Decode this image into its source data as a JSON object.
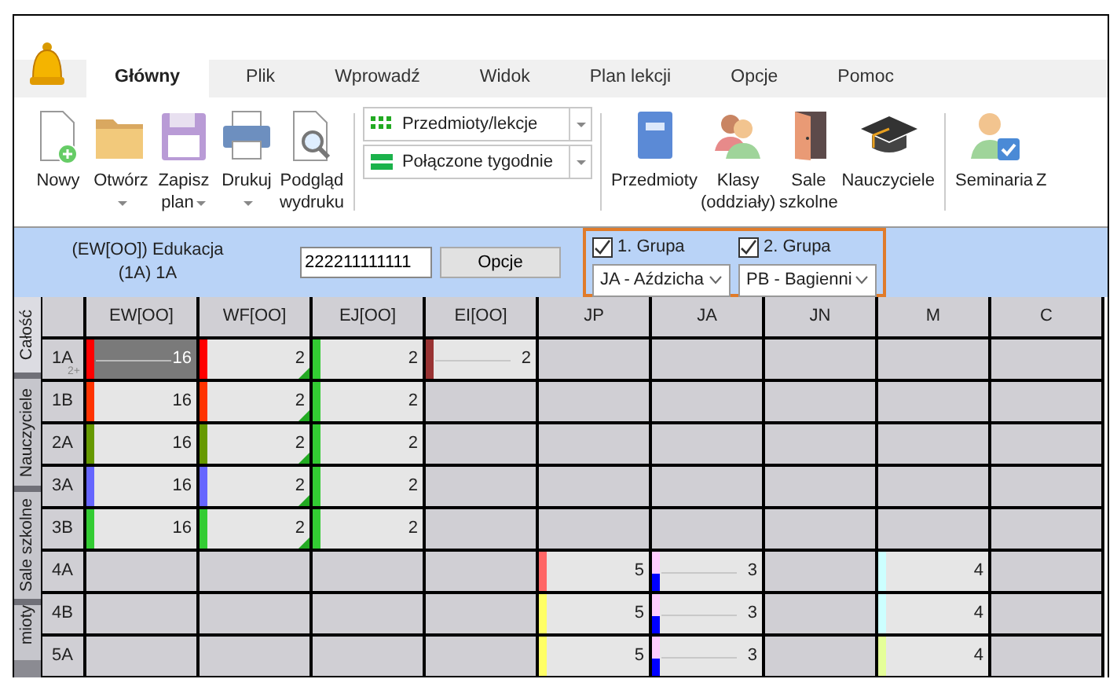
{
  "tabs": [
    {
      "label": "Główny",
      "selected": true
    },
    {
      "label": "Plik",
      "selected": false
    },
    {
      "label": "Wprowadź",
      "selected": false
    },
    {
      "label": "Widok",
      "selected": false
    },
    {
      "label": "Plan lekcji",
      "selected": false
    },
    {
      "label": "Opcje",
      "selected": false
    },
    {
      "label": "Pomoc",
      "selected": false
    }
  ],
  "ribbon": {
    "file_buttons": [
      {
        "label": "Nowy",
        "dropdown": false
      },
      {
        "label": "Otwórz",
        "dropdown": true
      },
      {
        "label": "Zapisz plan",
        "dropdown": true
      },
      {
        "label": "Drukuj",
        "dropdown": true
      },
      {
        "label": "Podgląd wydruku",
        "dropdown": false
      }
    ],
    "combos": [
      {
        "value": "Przedmioty/lekcje"
      },
      {
        "value": "Połączone tygodnie"
      }
    ],
    "data_buttons": [
      {
        "label": "Przedmioty"
      },
      {
        "label": "Klasy (oddziały)"
      },
      {
        "label": "Sale szkolne"
      },
      {
        "label": "Nauczyciele"
      }
    ],
    "extra_buttons": [
      {
        "label": "Seminaria"
      },
      {
        "label": "Z"
      }
    ]
  },
  "edit_bar": {
    "lesson": "(EW[OO]) Edukacja",
    "class": "(1A) 1A",
    "pattern": "222211111111",
    "options_button": "Opcje",
    "groups": [
      {
        "label": "1. Grupa",
        "checked": true,
        "teacher": "JA - Aździcha"
      },
      {
        "label": "2. Grupa",
        "checked": true,
        "teacher": "PB - Bagienni"
      }
    ]
  },
  "side_tabs": [
    {
      "label": "Całość",
      "selected": true
    },
    {
      "label": "Nauczyciele",
      "selected": false
    },
    {
      "label": "Sale szkolne",
      "selected": false
    },
    {
      "label": "mioty",
      "selected": false
    }
  ],
  "grid": {
    "columns": [
      "EW[OO]",
      "WF[OO]",
      "EJ[OO]",
      "EI[OO]",
      "JP",
      "JA",
      "JN",
      "M",
      "C"
    ],
    "rows": [
      {
        "label": "1A",
        "note": "2+",
        "cells": [
          {
            "text": "16",
            "color": "#ff0000",
            "selected": true,
            "marked": false,
            "kind": "linked"
          },
          {
            "text": "2",
            "color": "#ff0000",
            "selected": false,
            "marked": true,
            "kind": "plain"
          },
          {
            "text": "2",
            "color": "#33cc33",
            "selected": false,
            "marked": false,
            "kind": "plain"
          },
          {
            "text": "2",
            "color": "#993333",
            "selected": false,
            "marked": false,
            "kind": "linked"
          },
          null,
          null,
          null,
          null,
          null
        ]
      },
      {
        "label": "1B",
        "cells": [
          {
            "text": "16",
            "color": "#ff3300",
            "selected": false,
            "marked": false,
            "kind": "plain"
          },
          {
            "text": "2",
            "color": "#ff3300",
            "selected": false,
            "marked": true,
            "kind": "plain"
          },
          {
            "text": "2",
            "color": "#33cc33",
            "selected": false,
            "marked": false,
            "kind": "plain"
          },
          null,
          null,
          null,
          null,
          null,
          null
        ]
      },
      {
        "label": "2A",
        "cells": [
          {
            "text": "16",
            "color": "#669900",
            "selected": false,
            "marked": false,
            "kind": "plain"
          },
          {
            "text": "2",
            "color": "#669900",
            "selected": false,
            "marked": true,
            "kind": "plain"
          },
          {
            "text": "2",
            "color": "#33cc33",
            "selected": false,
            "marked": false,
            "kind": "plain"
          },
          null,
          null,
          null,
          null,
          null,
          null
        ]
      },
      {
        "label": "3A",
        "cells": [
          {
            "text": "16",
            "color": "#6666ff",
            "selected": false,
            "marked": false,
            "kind": "plain"
          },
          {
            "text": "2",
            "color": "#6666ff",
            "selected": false,
            "marked": true,
            "kind": "plain"
          },
          {
            "text": "2",
            "color": "#33cc33",
            "selected": false,
            "marked": false,
            "kind": "plain"
          },
          null,
          null,
          null,
          null,
          null,
          null
        ]
      },
      {
        "label": "3B",
        "cells": [
          {
            "text": "16",
            "color": "#33cc33",
            "selected": false,
            "marked": false,
            "kind": "plain"
          },
          {
            "text": "2",
            "color": "#33cc33",
            "selected": false,
            "marked": true,
            "kind": "plain"
          },
          {
            "text": "2",
            "color": "#33cc33",
            "selected": false,
            "marked": false,
            "kind": "plain"
          },
          null,
          null,
          null,
          null,
          null,
          null
        ]
      },
      {
        "label": "4A",
        "cells": [
          null,
          null,
          null,
          null,
          {
            "text": "5",
            "color": "#ff6666",
            "selected": false,
            "marked": false,
            "kind": "plain"
          },
          {
            "text": "3",
            "color": "#ffccff",
            "selected": false,
            "marked": false,
            "kind": "split"
          },
          null,
          {
            "text": "4",
            "color": "#ccffff",
            "selected": false,
            "marked": false,
            "kind": "plain"
          },
          null
        ]
      },
      {
        "label": "4B",
        "cells": [
          null,
          null,
          null,
          null,
          {
            "text": "5",
            "color": "#ffff66",
            "selected": false,
            "marked": false,
            "kind": "plain"
          },
          {
            "text": "3",
            "color": "#ffccff",
            "selected": false,
            "marked": false,
            "kind": "split"
          },
          null,
          {
            "text": "4",
            "color": "#ccffff",
            "selected": false,
            "marked": false,
            "kind": "plain"
          },
          null
        ]
      },
      {
        "label": "5A",
        "cells": [
          null,
          null,
          null,
          null,
          {
            "text": "5",
            "color": "#ffff66",
            "selected": false,
            "marked": false,
            "kind": "plain"
          },
          {
            "text": "3",
            "color": "#ffccff",
            "selected": false,
            "marked": false,
            "kind": "split"
          },
          null,
          {
            "text": "4",
            "color": "#e5ff99",
            "selected": false,
            "marked": false,
            "kind": "plain"
          },
          null
        ]
      }
    ]
  }
}
